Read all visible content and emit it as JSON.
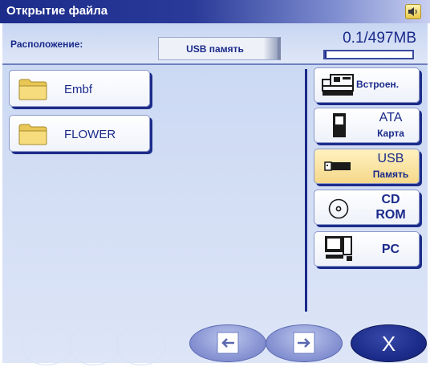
{
  "window": {
    "title": "Открытие файла",
    "sound_icon": "speaker-icon"
  },
  "location": {
    "label": "Расположение:",
    "value": "USB память",
    "memory_text": "0.1/497MB",
    "memory_used_fraction": 0.0002
  },
  "files": [
    {
      "name": "Embf",
      "icon": "folder-icon"
    },
    {
      "name": "FLOWER",
      "icon": "folder-icon"
    }
  ],
  "devices": [
    {
      "id": "builtin",
      "line1": "Встроен.",
      "line2": "",
      "icon": "embroidery-machine-icon",
      "selected": false
    },
    {
      "id": "ata",
      "line1": "ATA",
      "line2": "Карта",
      "icon": "ata-card-icon",
      "selected": false
    },
    {
      "id": "usb",
      "line1": "USB",
      "line2": "Память",
      "icon": "usb-stick-icon",
      "selected": true
    },
    {
      "id": "cd",
      "line1": "CD",
      "line2": "ROM",
      "icon": "cd-rom-icon",
      "selected": false
    },
    {
      "id": "pc",
      "line1": "PC",
      "line2": "",
      "icon": "pc-icon",
      "selected": false
    }
  ],
  "navigation": {
    "prev_icon": "arrow-left-icon",
    "next_icon": "arrow-right-icon",
    "close_label": "X"
  },
  "colors": {
    "accent": "#1a2a8a",
    "panel": "#d4def5",
    "selected": "#f5d88a"
  }
}
